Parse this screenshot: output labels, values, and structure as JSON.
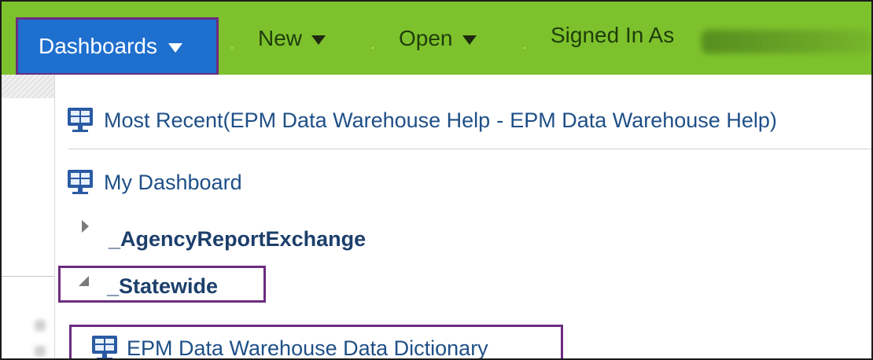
{
  "nav": {
    "dashboards_label": "Dashboards",
    "new_label": "New",
    "open_label": "Open",
    "signed_in_label": "Signed In As"
  },
  "menu": {
    "most_recent": {
      "label": "Most Recent(EPM Data Warehouse Help",
      "separator": "-",
      "label_tail": "EPM Data Warehouse Help)"
    },
    "my_dashboard_label": "My Dashboard",
    "folders": [
      {
        "label": "_AgencyReportExchange",
        "expanded": false
      },
      {
        "label": "_Statewide",
        "expanded": true
      }
    ],
    "dictionary_label": "EPM Data Warehouse Data Dictionary"
  },
  "colors": {
    "nav_background": "#7dc22c",
    "active_menu": "#1f6fcf",
    "highlight_border": "#6b2d7f",
    "link_text": "#1e4f87"
  },
  "icons": {
    "dropdown": "caret-down-icon",
    "dashboard": "dashboard-monitor-icon",
    "collapsed_folder": "triangle-right-icon",
    "expanded_folder": "triangle-down-icon"
  }
}
